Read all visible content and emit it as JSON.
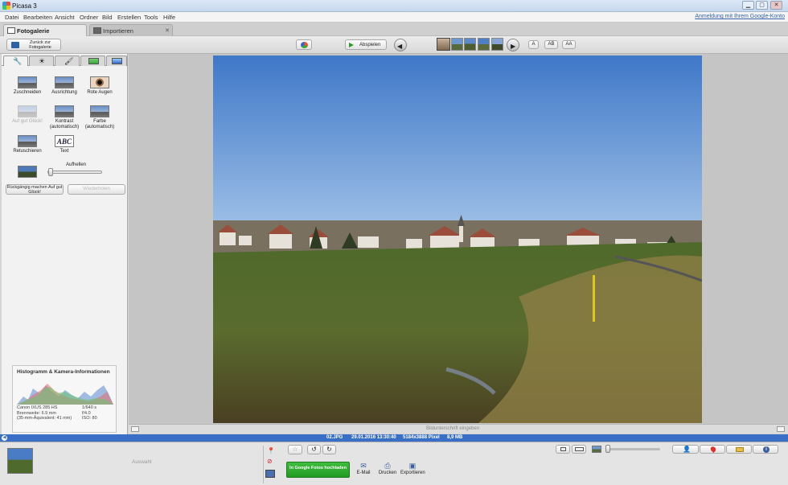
{
  "window": {
    "title": "Picasa 3",
    "min": "▁",
    "max": "▢",
    "close": "✕"
  },
  "menu": {
    "items": [
      "Datei",
      "Bearbeiten",
      "Ansicht",
      "Ordner",
      "Bild",
      "Erstellen",
      "Tools",
      "Hilfe"
    ],
    "signin": "Anmeldung mit Ihrem Google-Konto"
  },
  "tabs": [
    {
      "label": "Fotogalerie"
    },
    {
      "label": "Importieren"
    }
  ],
  "toolbar": {
    "back_label": "Zurück zur Fotogalerie",
    "play_label": "Abspielen",
    "text_sizes": [
      "A",
      "AB",
      "AA"
    ]
  },
  "editor": {
    "tools": [
      {
        "label": "Zuschneiden"
      },
      {
        "label": "Ausrichtung"
      },
      {
        "label": "Rote Augen"
      },
      {
        "label": "Auf gut Glück!"
      },
      {
        "label": "Kontrast (automatisch)"
      },
      {
        "label": "Farbe (automatisch)"
      },
      {
        "label": "Retuschieren"
      },
      {
        "label": "Text"
      }
    ],
    "fill_light_label": "Aufhellen",
    "fill_light_level": 0,
    "undo_label": "Rückgängig machen Auf gut Glück!",
    "redo_label": "Wiederholen",
    "text_tool_glyph": "ABC"
  },
  "histogram": {
    "title": "Histogramm & Kamera-Informationen",
    "camera": "Canon IXUS 285 HS",
    "focal": "Brennweite: 6.9 mm",
    "equiv": "(35-mm-Äquivalent:  41 mm)",
    "exposure": "1/640 s",
    "aperture": "f/4.0",
    "iso": "ISO: 80"
  },
  "caption_placeholder": "Bildunterschrift eingeben",
  "info": {
    "filename": "02.JPG",
    "date": "29.01.2016 13:30:40",
    "size": "5184x3888 Pixel",
    "filesize": "8,9 MB"
  },
  "bottom": {
    "selection_label": "Auswahl",
    "upload_label": "In Google Fotos hochladen",
    "email_label": "E-Mail",
    "print_label": "Drucken",
    "export_label": "Exportieren"
  },
  "colors": {
    "accent": "#3a6fc7",
    "upload": "#2ea82e"
  }
}
